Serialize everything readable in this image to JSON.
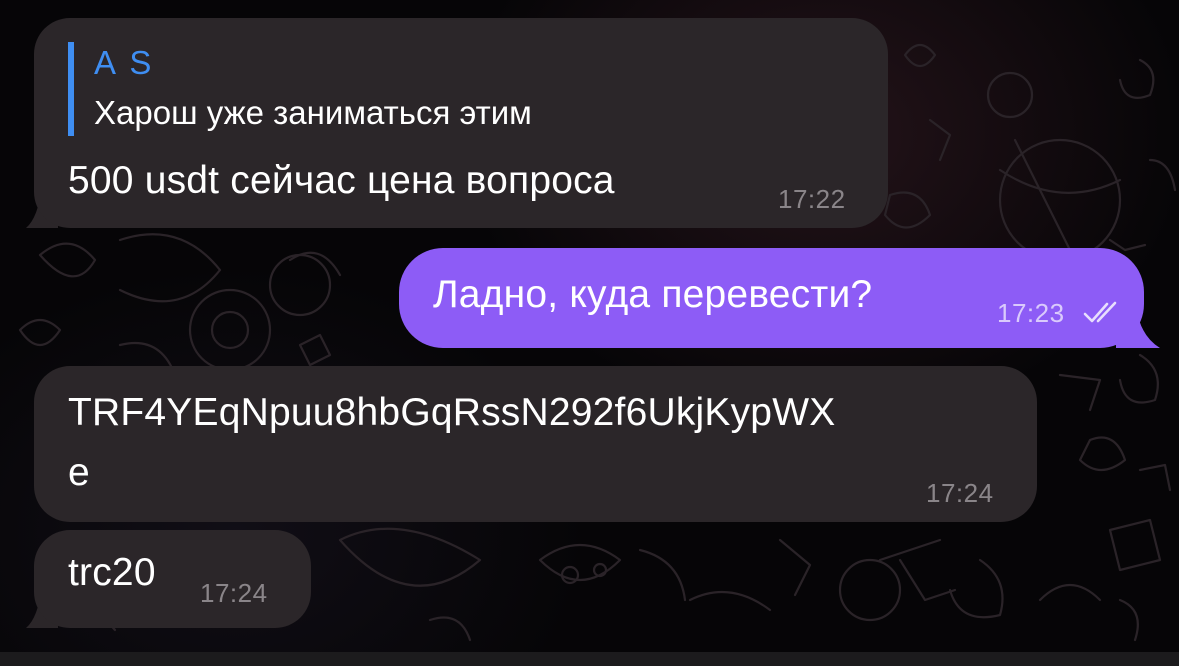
{
  "colors": {
    "incoming_bubble": "#2b2629",
    "outgoing_bubble": "#8d5cf6",
    "reply_accent": "#3f8ef2",
    "background": "#060507"
  },
  "messages": [
    {
      "direction": "incoming",
      "reply": {
        "author": "A S",
        "text": "Харош уже заниматься этим"
      },
      "text": "500 usdt сейчас цена вопроса",
      "time": "17:22"
    },
    {
      "direction": "outgoing",
      "text": "Ладно, куда перевести?",
      "time": "17:23",
      "status_icon": "double-check-icon"
    },
    {
      "direction": "incoming",
      "text_line1": "TRF4YEqNpuu8hbGqRssN292f6UkjKypWX",
      "text_line2": "e",
      "time": "17:24"
    },
    {
      "direction": "incoming",
      "text": "trc20",
      "time": "17:24"
    }
  ]
}
